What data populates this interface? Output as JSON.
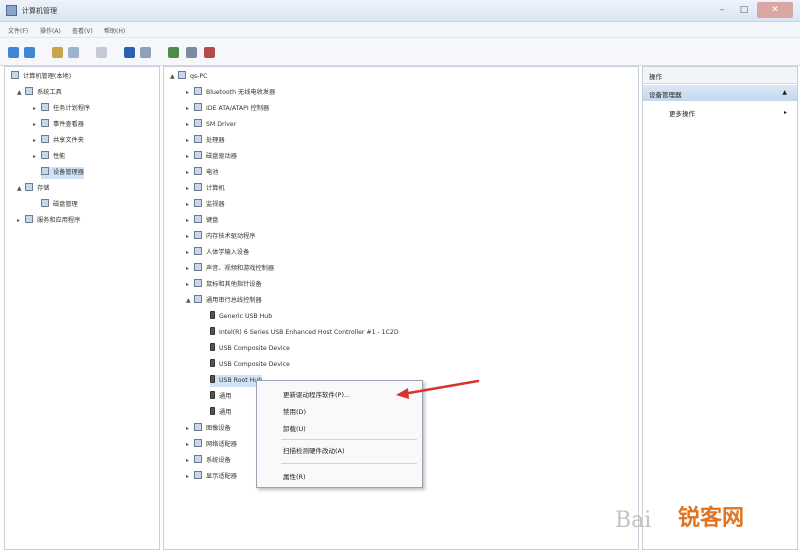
{
  "window": {
    "title": "计算机管理",
    "controls": {
      "minimize": "–",
      "maximize": "□",
      "close": "✕"
    }
  },
  "menu": [
    "文件(F)",
    "操作(A)",
    "查看(V)",
    "帮助(H)"
  ],
  "toolbar_icons": [
    "back-icon",
    "forward-icon",
    "up-icon",
    "show-hide-tree-icon",
    "properties-icon",
    "help-icon",
    "scan-hardware-icon",
    "update-driver-icon",
    "disable-icon",
    "uninstall-icon"
  ],
  "left_tree": [
    {
      "label": "计算机管理(本地)",
      "expand": "",
      "icon": "computer-icon"
    },
    {
      "label": "系统工具",
      "expand": "▲",
      "icon": "tools-icon"
    },
    {
      "label": "任务计划程序",
      "expand": "▸",
      "icon": "task-scheduler-icon"
    },
    {
      "label": "事件查看器",
      "expand": "▸",
      "icon": "event-viewer-icon"
    },
    {
      "label": "共享文件夹",
      "expand": "▸",
      "icon": "shared-folder-icon"
    },
    {
      "label": "性能",
      "expand": "▸",
      "icon": "performance-icon"
    },
    {
      "label": "设备管理器",
      "expand": "",
      "icon": "device-manager-icon"
    },
    {
      "label": "存储",
      "expand": "▲",
      "icon": "storage-icon"
    },
    {
      "label": "磁盘管理",
      "expand": "",
      "icon": "disk-icon"
    },
    {
      "label": "服务和应用程序",
      "expand": "▸",
      "icon": "services-icon"
    }
  ],
  "device_tree": {
    "root": "qs-PC",
    "categories": [
      "Bluetooth 无线电收发器",
      "IDE ATA/ATAPI 控制器",
      "SM Driver",
      "处理器",
      "磁盘驱动器",
      "电池",
      "计算机",
      "监视器",
      "键盘",
      "内存技术驱动程序",
      "人体学输入设备",
      "声音、视频和游戏控制器",
      "鼠标和其他指针设备",
      "通用串行总线控制器"
    ],
    "usb_children": [
      "Generic USB Hub",
      "Intel(R) 6 Series USB Enhanced Host Controller #1 - 1C2D",
      "USB Composite Device",
      "USB Composite Device",
      "USB Root Hub",
      "通用",
      "通用"
    ],
    "bottom_categories": [
      "图像设备",
      "网络适配器",
      "系统设备",
      "显示适配器"
    ]
  },
  "context_menu": {
    "items": [
      "更新驱动程序软件(P)...",
      "禁用(D)",
      "卸载(U)",
      "扫描检测硬件改动(A)",
      "属性(R)"
    ]
  },
  "actions_pane": {
    "header": "操作",
    "selected": "设备管理器",
    "more": "更多操作"
  },
  "annotation": {
    "color": "#d9342b"
  },
  "watermarks": {
    "baidu": "Bai",
    "site": "锐客网"
  }
}
